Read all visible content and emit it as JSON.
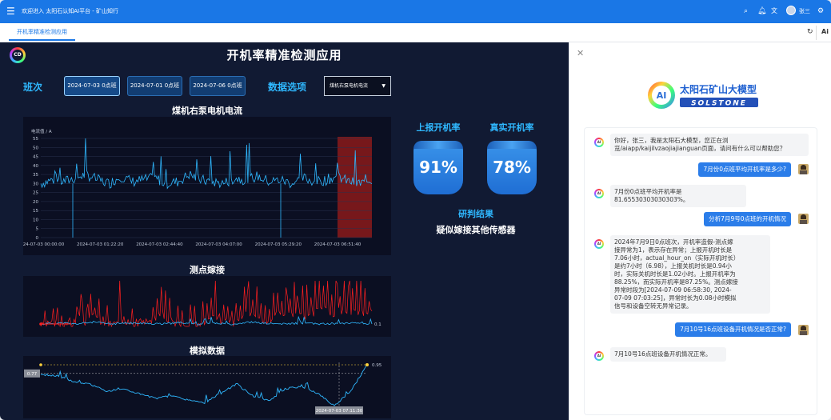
{
  "topbar": {
    "title": "欢迎进入 太阳石认知AI平台 - 矿山知行",
    "user": "张三",
    "icons": [
      "menu-icon",
      "search-icon",
      "bell-icon",
      "translate-icon",
      "avatar",
      "settings-icon"
    ],
    "color": "#1a77e6"
  },
  "tabs": [
    {
      "label": "开机率精准检测应用",
      "active": true
    }
  ],
  "dashboard": {
    "title": "开机率精准检测应用",
    "logo_text": "CD",
    "shift_label": "班次",
    "shifts": [
      {
        "label": "2024-07-03 0点班",
        "selected": true
      },
      {
        "label": "2024-07-01 0点班",
        "selected": false
      },
      {
        "label": "2024-07-06 0点班",
        "selected": false
      }
    ],
    "data_option_label": "数据选项",
    "data_option_value": "煤机右泵电机电流",
    "reported_rate_label": "上报开机率",
    "reported_rate_value": "91%",
    "actual_rate_label": "真实开机率",
    "actual_rate_value": "78%",
    "result_label": "研判结果",
    "result_value": "疑似嫁接其他传感器"
  },
  "chart_data": [
    {
      "type": "line",
      "title": "煤机右泵电机电流",
      "ylabel": "电流值 / A",
      "ylim": [
        0,
        55
      ],
      "yticks": [
        "55",
        "50",
        "45",
        "40",
        "35",
        "30",
        "25",
        "20",
        "15",
        "10",
        "5",
        "0"
      ],
      "x_ticks": [
        "2024-07-03 00:00:00",
        "2024-07-03 01:22:20",
        "2024-07-03 02:44:40",
        "2024-07-03 04:07:00",
        "2024-07-03 05:29:20",
        "2024-07-03 06:51:40"
      ],
      "series": [
        {
          "values": [
            30,
            32,
            31,
            33,
            35,
            32,
            30,
            34,
            31,
            32,
            33,
            30,
            31,
            35,
            32,
            31,
            30,
            33,
            32,
            34,
            31,
            32,
            30,
            33,
            31,
            32,
            34,
            31,
            30,
            32
          ]
        }
      ],
      "highlight_from": "2024-07-03 06:51:40",
      "line_color": "#2fb8ff",
      "highlight_color": "#8b1a1a"
    },
    {
      "type": "line",
      "title": "测点嫁接",
      "annotations": [
        "0.1"
      ],
      "series": [
        {
          "color": "#2fb8ff",
          "values": [
            0.1,
            0.12,
            0.1,
            0.14,
            0.1,
            0.12,
            0.11,
            0.1,
            0.13,
            0.1,
            0.12,
            0.1,
            0.14,
            0.11,
            0.1,
            0.12,
            0.1,
            0.11,
            0.13,
            0.1
          ]
        },
        {
          "color": "#ff2020",
          "values": [
            0.1,
            0.3,
            0.15,
            0.6,
            0.2,
            0.4,
            0.25,
            0.7,
            0.2,
            0.35,
            0.5,
            0.3,
            0.8,
            0.4,
            0.9,
            0.7,
            0.95,
            0.85,
            0.9,
            0.8
          ]
        }
      ]
    },
    {
      "type": "line",
      "title": "模拟数据",
      "annotations": [
        "0.95",
        "0.77",
        "2024-07-03 07:11:30"
      ],
      "series": [
        {
          "color": "#2fb8ff",
          "values": [
            0.75,
            0.72,
            0.6,
            0.55,
            0.4,
            0.45,
            0.35,
            0.25,
            0.3,
            0.22,
            0.15,
            0.35,
            0.55,
            0.3,
            0.2,
            0.45,
            0.5,
            0.35,
            0.1,
            0.4,
            0.95
          ]
        }
      ]
    }
  ],
  "ai_panel": {
    "brand_cn": "太阳石矿山大模型",
    "brand_en": "SOLSTONE",
    "messages": [
      {
        "role": "bot",
        "text": "你好，张三，我是太阳石大模型，您正在浏\n览/aiapp/kaijilvzaojiajianguan页面，请问有什么可以帮助您？"
      },
      {
        "role": "user",
        "text": "7月份0点班平均开机率是多少?"
      },
      {
        "role": "bot",
        "text": "7月份0点班平均开机率是\n81.65530303030303%。"
      },
      {
        "role": "user",
        "text": "分析7月9号0点班的开机情况"
      },
      {
        "role": "bot",
        "text": "2024年7月9日0点班次，开机率造假-测点嫁\n接异常为1，表示存在异常；上报开机时长是\n7.06小时，actual_hour_on（实际开机时长）\n是约7小时（6.98），上报关机时长是0.94小\n时，实际关机时长是1.02小时。上报开机率为\n88.25%，而实际开机率是87.25%。测点嫁接\n异常时段为[2024-07-09 06:58:30, 2024-\n07-09 07:03:25]，异常时长为0.08小时模拟\n信号和设备空转无异常记录。"
      },
      {
        "role": "user",
        "text": "7月10号16点班设备开机情况是否正常?"
      },
      {
        "role": "bot",
        "text": "7月10号16点班设备开机情况正常。"
      }
    ]
  }
}
